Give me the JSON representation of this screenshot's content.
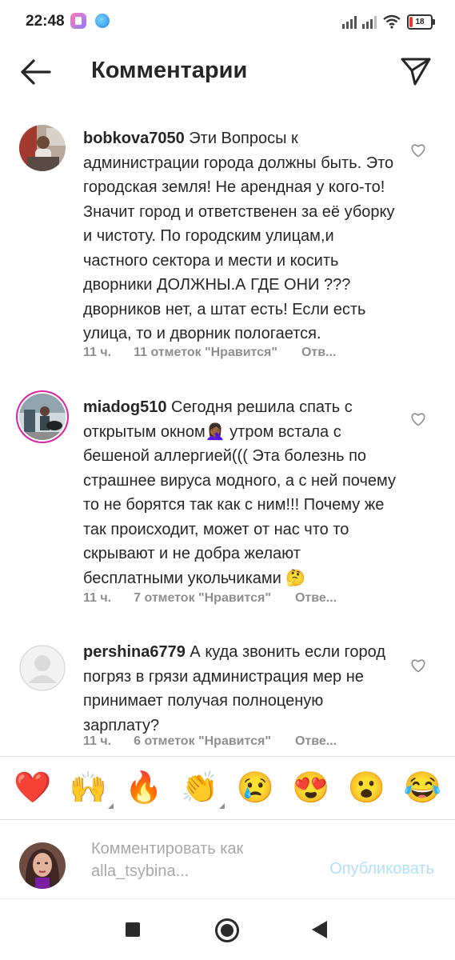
{
  "status_bar": {
    "time": "22:48",
    "battery": "18"
  },
  "header": {
    "title": "Комментарии"
  },
  "comments": [
    {
      "username": "bobkova7050",
      "text": "Эти Вопросы к администрации города должны быть. Это городская земля! Не арендная у кого-то! Значит город и ответственен за её уборку и чистоту. По городским улицам,и частного сектора и мести и косить дворники ДОЛЖНЫ.А ГДЕ ОНИ ??? дворников нет, а штат есть! Если есть улица, то и дворник  пологается.",
      "time": "11 ч.",
      "likes": "11 отметок \"Нравится\"",
      "reply": "Отв..."
    },
    {
      "username": "miadog510",
      "text": "Сегодня решила спать с открытым окном🤦🏾‍♀️ утром встала с бешеной аллергией((( Эта болезнь по страшнее вируса модного, а с ней почему то не борятся так как с ним!!! Почему же так происходит, может от нас что то скрывают и не добра желают бесплатными укольчиками 🤔",
      "time": "11 ч.",
      "likes": "7 отметок \"Нравится\"",
      "reply": "Отве..."
    },
    {
      "username": "pershina6779",
      "text": "А куда звонить если город погряз в грязи администрация мер не принимает получая полноценую зарплату?",
      "time": "11 ч.",
      "likes": "6 отметок \"Нравится\"",
      "reply": "Отве..."
    }
  ],
  "emojis": [
    "❤️",
    "🙌",
    "🔥",
    "👏",
    "😢",
    "😍",
    "😮",
    "😂"
  ],
  "compose": {
    "placeholder": "Комментировать как alla_tsybina...",
    "publish": "Опубликовать"
  },
  "colors": {
    "text": "#262626",
    "muted": "#8e8e8e",
    "publish_disabled": "#b2dffc",
    "story_ring": "#d6249f"
  },
  "icons": [
    "back-arrow-icon",
    "send-icon",
    "heart-icon",
    "nav-recents-icon",
    "nav-home-icon",
    "nav-back-icon"
  ]
}
